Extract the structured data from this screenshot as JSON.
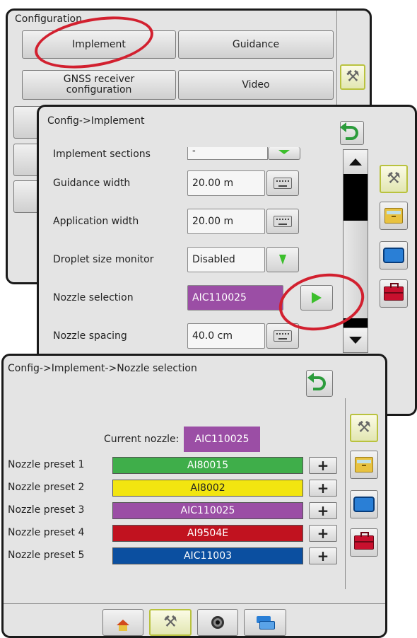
{
  "panel1": {
    "title": "Configuration",
    "buttons": {
      "implement": "Implement",
      "guidance": "Guidance",
      "gnss": "GNSS receiver configuration",
      "video": "Video"
    }
  },
  "panel2": {
    "title": "Config->Implement",
    "rows": [
      {
        "label": "Implement sections",
        "value": "-"
      },
      {
        "label": "Guidance width",
        "value": "20.00 m"
      },
      {
        "label": "Application width",
        "value": "20.00 m"
      },
      {
        "label": "Droplet size monitor",
        "value": "Disabled"
      },
      {
        "label": "Nozzle selection",
        "value": "AIC110025"
      },
      {
        "label": "Nozzle spacing",
        "value": "40.0 cm"
      }
    ]
  },
  "panel3": {
    "title": "Config->Implement->Nozzle selection",
    "current_label": "Current nozzle:",
    "current_value": "AIC110025",
    "presets": [
      {
        "label": "Nozzle preset 1",
        "value": "AI80015",
        "color": "#3fae4a",
        "text_color": "#ffffff"
      },
      {
        "label": "Nozzle preset 2",
        "value": "AI8002",
        "color": "#f2e510",
        "text_color": "#222222"
      },
      {
        "label": "Nozzle preset 3",
        "value": "AIC110025",
        "color": "#9b4ea5",
        "text_color": "#ffffff"
      },
      {
        "label": "Nozzle preset 4",
        "value": "AI9504E",
        "color": "#c1121f",
        "text_color": "#ffffff"
      },
      {
        "label": "Nozzle preset 5",
        "value": "AIC11003",
        "color": "#0b4fa0",
        "text_color": "#ffffff"
      }
    ],
    "plus_label": "+"
  },
  "colors": {
    "highlight_purple": "#9b4ea5",
    "callout_red": "#d2202f",
    "arrow_green": "#3cbf2c"
  },
  "icons": [
    "tools-icon",
    "folder-icon",
    "screen-icon",
    "toolbox-icon",
    "back-icon",
    "home-icon",
    "camera-icon",
    "layers-icon",
    "keyboard-icon",
    "down-arrow-icon",
    "right-arrow-icon",
    "scroll-up-icon",
    "scroll-down-icon"
  ]
}
